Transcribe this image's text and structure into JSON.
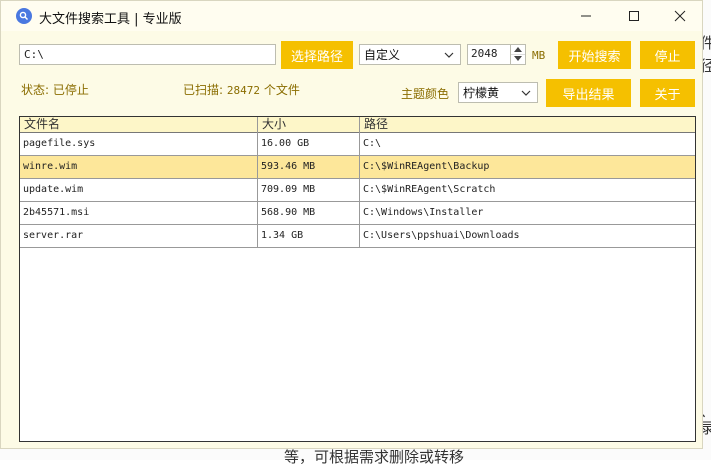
{
  "window": {
    "title": "大文件搜索工具 | 专业版"
  },
  "toolbar": {
    "path_value": "C:\\",
    "choose_path_label": "选择路径",
    "size_mode": "自定义",
    "size_value": "2048",
    "size_unit": "MB",
    "start_label": "开始搜索",
    "stop_label": "停止"
  },
  "status": {
    "status_text": "状态: 已停止",
    "scanned_label": "已扫描:",
    "scanned_count": "28472",
    "scanned_unit": "个文件",
    "theme_label": "主题颜色",
    "theme_value": "柠檬黄",
    "export_label": "导出结果",
    "about_label": "关于"
  },
  "table": {
    "headers": [
      "文件名",
      "大小",
      "路径"
    ],
    "rows": [
      {
        "name": "pagefile.sys",
        "size": "16.00 GB",
        "path": "C:\\"
      },
      {
        "name": "winre.wim",
        "size": "593.46 MB",
        "path": "C:\\$WinREAgent\\Backup"
      },
      {
        "name": "update.wim",
        "size": "709.09 MB",
        "path": "C:\\$WinREAgent\\Scratch"
      },
      {
        "name": "2b45571.msi",
        "size": "568.90 MB",
        "path": "C:\\Windows\\Installer"
      },
      {
        "name": "server.rar",
        "size": "1.34 GB",
        "path": "C:\\Users\\ppshuai\\Downloads"
      }
    ],
    "selected_row": 1
  },
  "background": {
    "frag_1": "件",
    "frag_2": "径",
    "frag_3": "、",
    "frag_4": "录",
    "frag_5": "等，可根据需求删除或转移"
  },
  "colors": {
    "accent": "#f5c000",
    "window_bg": "#fdfbe6",
    "selected_row": "#fde79a"
  }
}
